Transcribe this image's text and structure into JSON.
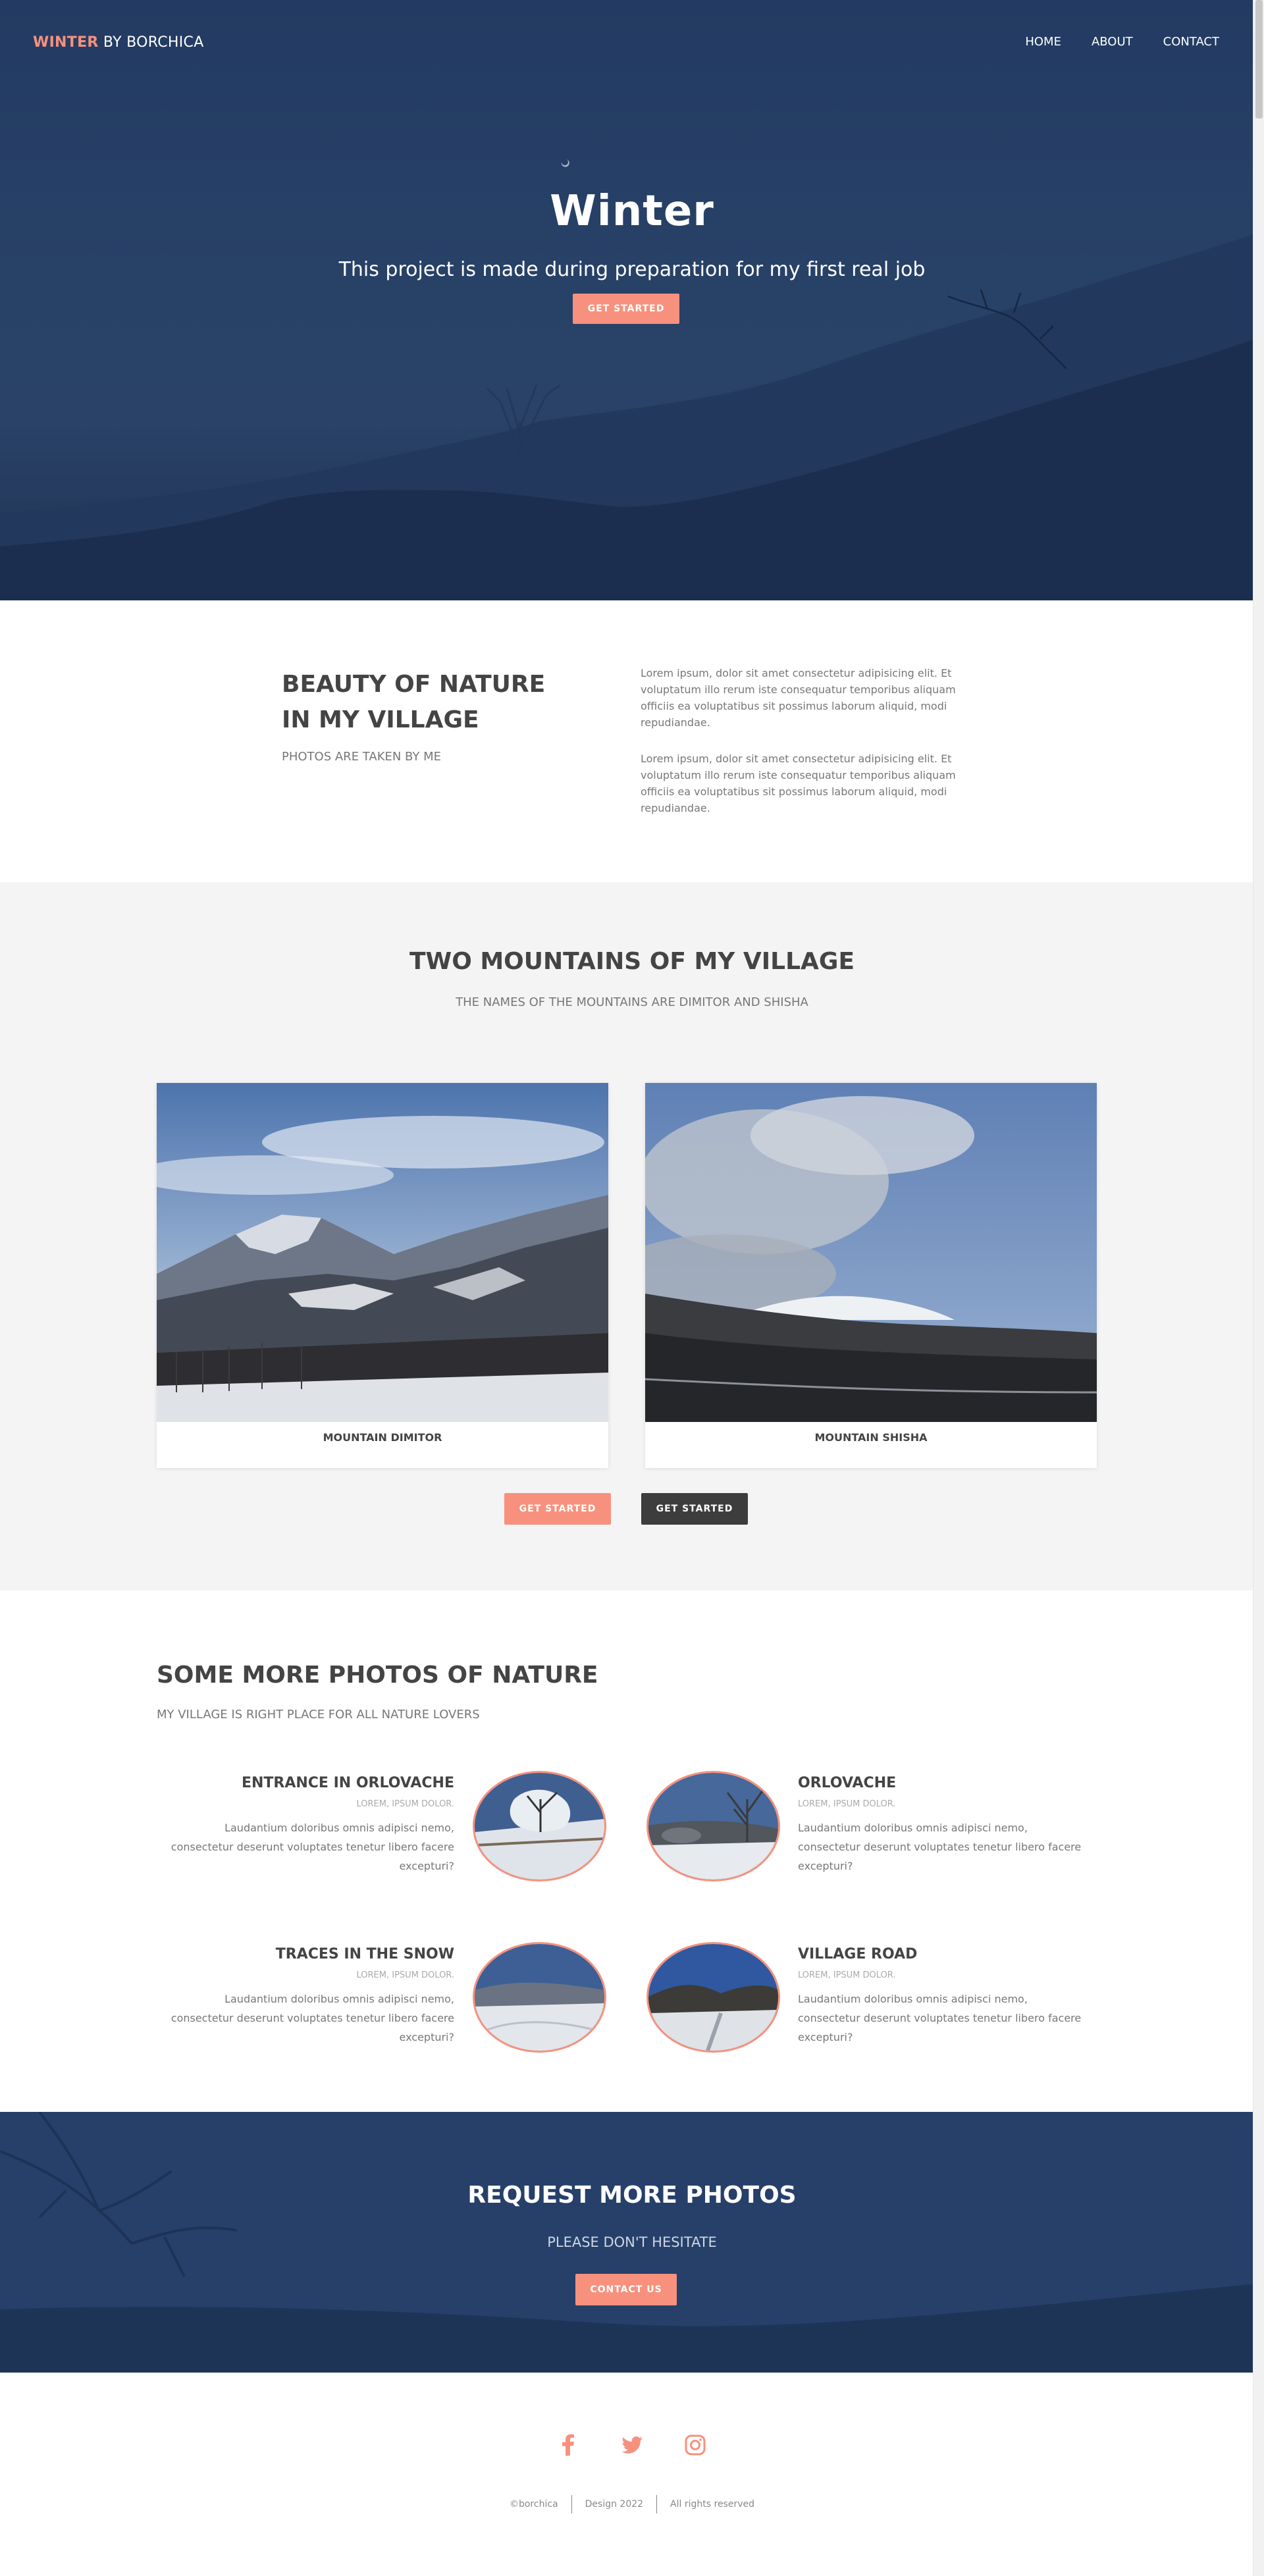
{
  "nav": {
    "brand_accent": "WINTER",
    "brand_rest": " BY BORCHICA",
    "links": [
      "HOME",
      "ABOUT",
      "CONTACT"
    ]
  },
  "hero": {
    "title": "Winter",
    "subtitle": "This project is made during preparation for my first real job",
    "button": "GET STARTED"
  },
  "beauty": {
    "title_line1": "BEAUTY OF NATURE",
    "title_line2": "IN MY VILLAGE",
    "subtitle": "PHOTOS ARE TAKEN BY ME",
    "paragraphs": [
      "Lorem ipsum, dolor sit amet consectetur adipisicing elit. Et voluptatum illo rerum iste consequatur temporibus aliquam officiis ea voluptatibus sit possimus laborum aliquid, modi repudiandae.",
      "Lorem ipsum, dolor sit amet consectetur adipisicing elit. Et voluptatum illo rerum iste consequatur temporibus aliquam officiis ea voluptatibus sit possimus laborum aliquid, modi repudiandae."
    ]
  },
  "mountains": {
    "title": "TWO MOUNTAINS OF MY VILLAGE",
    "subtitle": "THE NAMES OF THE MOUNTAINS ARE DIMITOR AND SHISHA",
    "cards": [
      "MOUNTAIN DIMITOR",
      "MOUNTAIN SHISHA"
    ],
    "button_primary": "GET STARTED",
    "button_secondary": "GET STARTED"
  },
  "more": {
    "title": "SOME MORE PHOTOS OF NATURE",
    "subtitle": "MY VILLAGE IS RIGHT PLACE FOR ALL NATURE LOVERS",
    "items": [
      {
        "title": "ENTRANCE IN ORLOVACHE",
        "small": "LOREM, IPSUM DOLOR.",
        "text": "Laudantium doloribus omnis adipisci nemo, consectetur deserunt voluptates tenetur libero facere excepturi?"
      },
      {
        "title": "ORLOVACHE",
        "small": "LOREM, IPSUM DOLOR.",
        "text": "Laudantium doloribus omnis adipisci nemo, consectetur deserunt voluptates tenetur libero facere excepturi?"
      },
      {
        "title": "TRACES IN THE SNOW",
        "small": "LOREM, IPSUM DOLOR.",
        "text": "Laudantium doloribus omnis adipisci nemo, consectetur deserunt voluptates tenetur libero facere excepturi?"
      },
      {
        "title": "VILLAGE ROAD",
        "small": "LOREM, IPSUM DOLOR.",
        "text": "Laudantium doloribus omnis adipisci nemo, consectetur deserunt voluptates tenetur libero facere excepturi?"
      }
    ]
  },
  "request": {
    "title": "REQUEST MORE PHOTOS",
    "subtitle": "PLEASE DON'T HESITATE",
    "button": "CONTACT US"
  },
  "footer": {
    "social_icons": [
      "facebook-icon",
      "twitter-icon",
      "instagram-icon"
    ],
    "copyright": "©borchica",
    "design": "Design 2022",
    "rights": "All rights reserved"
  },
  "colors": {
    "accent": "#f7917d",
    "dark_button": "#3d3d3d",
    "hero_blue": "#27406a",
    "section_gray": "#f4f4f4"
  }
}
